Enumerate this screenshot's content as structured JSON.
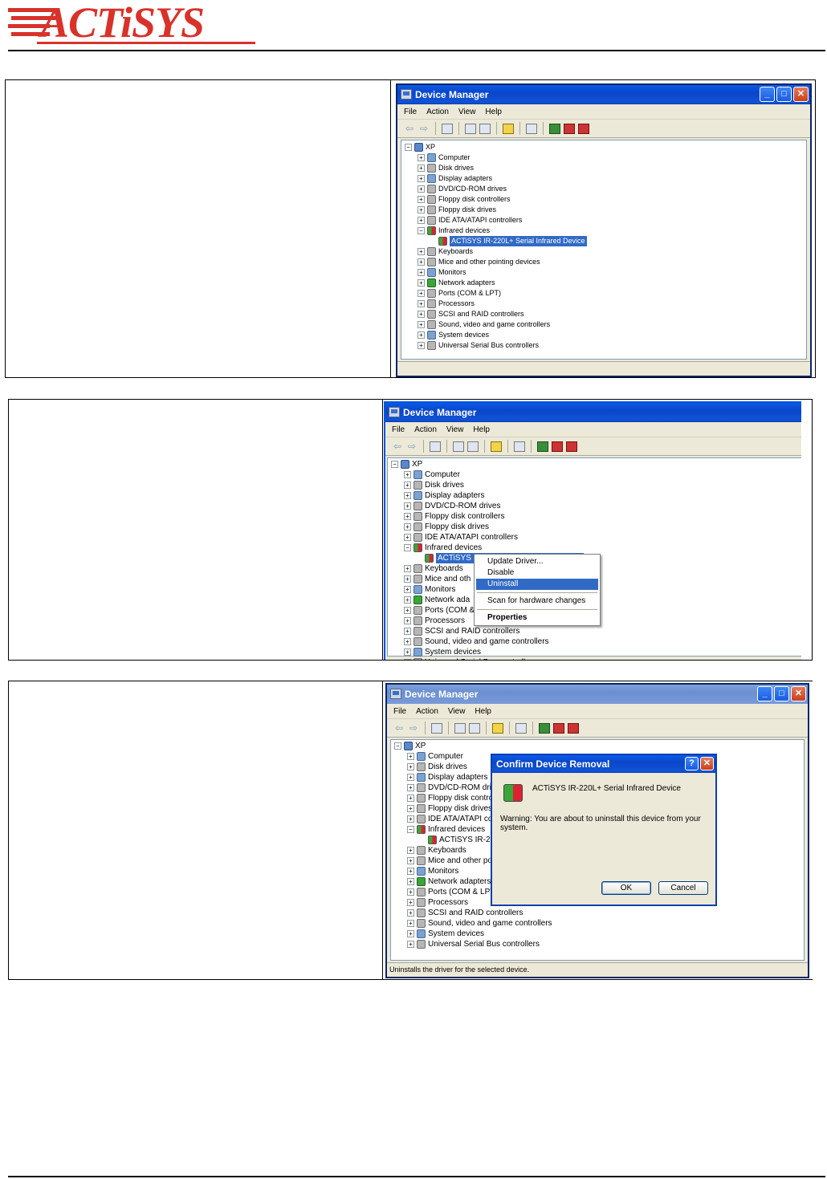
{
  "brand": {
    "logo_text": "ACTiSYS"
  },
  "window_title": "Device Manager",
  "menu": [
    "File",
    "Action",
    "View",
    "Help"
  ],
  "tree": {
    "root": "XP",
    "categories": [
      "Computer",
      "Disk drives",
      "Display adapters",
      "DVD/CD-ROM drives",
      "Floppy disk controllers",
      "Floppy disk drives",
      "IDE ATA/ATAPI controllers",
      "Infrared devices",
      "Keyboards",
      "Mice and other pointing devices",
      "Monitors",
      "Network adapters",
      "Ports (COM & LPT)",
      "Processors",
      "SCSI and RAID controllers",
      "Sound, video and game controllers",
      "System devices",
      "Universal Serial Bus controllers"
    ],
    "infrared_child": "ACTiSYS IR-220L+ Serial Infrared Device"
  },
  "shot2": {
    "device_truncated": "ACTiSYS",
    "truncated": {
      "mice": "Mice and oth",
      "network": "Network ada",
      "ports": "Ports (COM &"
    },
    "context_menu": [
      "Update Driver...",
      "Disable",
      "Uninstall",
      "Scan for hardware changes",
      "Properties"
    ]
  },
  "shot3": {
    "truncated": {
      "dvd": "DVD/CD-ROM driv",
      "floppy_ctrl": "Floppy disk contro",
      "floppy_drv": "Floppy disk drives",
      "ide": "IDE ATA/ATAPI co",
      "device": "ACTiSYS IR-2",
      "mice": "Mice and other po",
      "network": "Network adapters",
      "ports": "Ports (COM & LPT"
    },
    "dialog": {
      "title": "Confirm Device Removal",
      "device": "ACTiSYS IR-220L+ Serial Infrared Device",
      "warning": "Warning: You are about to uninstall this device from your system.",
      "ok": "OK",
      "cancel": "Cancel"
    },
    "status": "Uninstalls the driver for the selected device."
  },
  "colors": {
    "brand_red": "#d8322a",
    "xp_blue": "#0a46c8",
    "selection": "#316ac5"
  }
}
